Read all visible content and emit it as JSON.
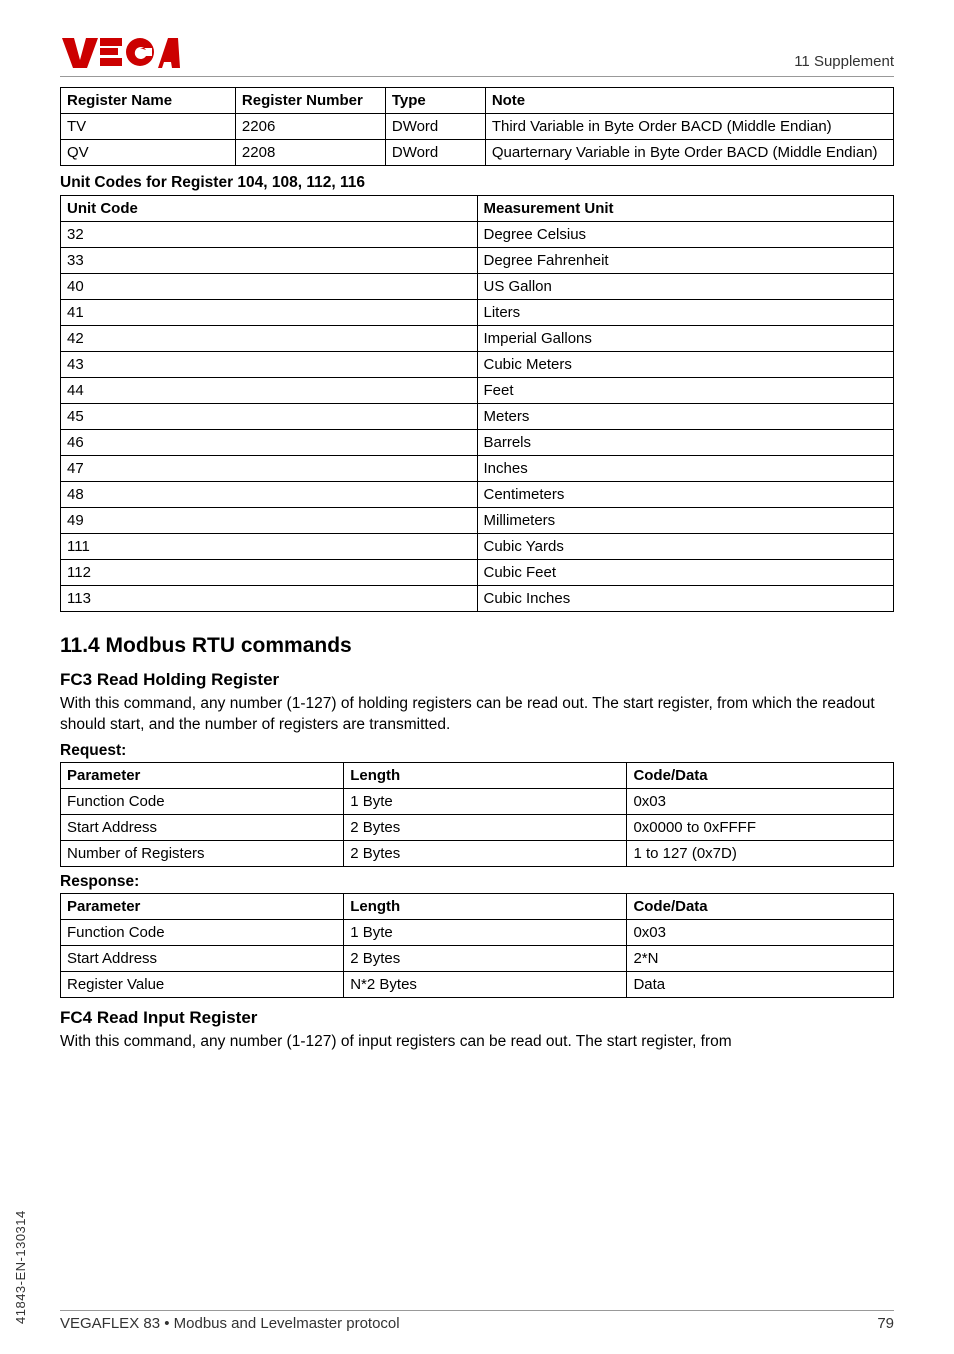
{
  "header": {
    "logo_text": "VEGA",
    "supplement": "11 Supplement"
  },
  "register_table": {
    "headers": [
      "Register Name",
      "Register Number",
      "Type",
      "Note"
    ],
    "rows": [
      [
        "TV",
        "2206",
        "DWord",
        "Third Variable in Byte Order BACD (Middle Endian)"
      ],
      [
        "QV",
        "2208",
        "DWord",
        "Quarternary Variable in Byte Order BACD (Middle Endian)"
      ]
    ]
  },
  "unit_codes_heading": "Unit Codes for Register 104, 108, 112, 116",
  "unit_codes_table": {
    "headers": [
      "Unit Code",
      "Measurement Unit"
    ],
    "rows": [
      [
        "32",
        "Degree Celsius"
      ],
      [
        "33",
        "Degree Fahrenheit"
      ],
      [
        "40",
        "US Gallon"
      ],
      [
        "41",
        "Liters"
      ],
      [
        "42",
        "Imperial Gallons"
      ],
      [
        "43",
        "Cubic Meters"
      ],
      [
        "44",
        "Feet"
      ],
      [
        "45",
        "Meters"
      ],
      [
        "46",
        "Barrels"
      ],
      [
        "47",
        "Inches"
      ],
      [
        "48",
        "Centimeters"
      ],
      [
        "49",
        "Millimeters"
      ],
      [
        "111",
        "Cubic Yards"
      ],
      [
        "112",
        "Cubic Feet"
      ],
      [
        "113",
        "Cubic Inches"
      ]
    ]
  },
  "section_11_4": {
    "title": "11.4   Modbus RTU commands",
    "fc3": {
      "heading": "FC3 Read Holding Register",
      "body": "With this command, any number (1-127) of holding registers can be read out. The start register, from which the readout should start, and the number of registers are transmitted.",
      "request_label": "Request:",
      "request_table": {
        "headers": [
          "Parameter",
          "Length",
          "Code/Data"
        ],
        "rows": [
          [
            "Function Code",
            "1 Byte",
            "0x03"
          ],
          [
            "Start Address",
            "2 Bytes",
            "0x0000 to 0xFFFF"
          ],
          [
            "Number of Registers",
            "2 Bytes",
            "1 to 127 (0x7D)"
          ]
        ]
      },
      "response_label": "Response:",
      "response_table": {
        "headers": [
          "Parameter",
          "Length",
          "Code/Data"
        ],
        "rows": [
          [
            "Function Code",
            "1 Byte",
            "0x03"
          ],
          [
            "Start Address",
            "2 Bytes",
            "2*N"
          ],
          [
            "Register Value",
            "N*2 Bytes",
            "Data"
          ]
        ]
      }
    },
    "fc4": {
      "heading": "FC4 Read Input Register",
      "body": "With this command, any number (1-127) of input registers can be read out. The start register, from"
    }
  },
  "footer": {
    "left": "VEGAFLEX 83 • Modbus and Levelmaster protocol",
    "right": "79"
  },
  "sidelabel": "41843-EN-130314"
}
